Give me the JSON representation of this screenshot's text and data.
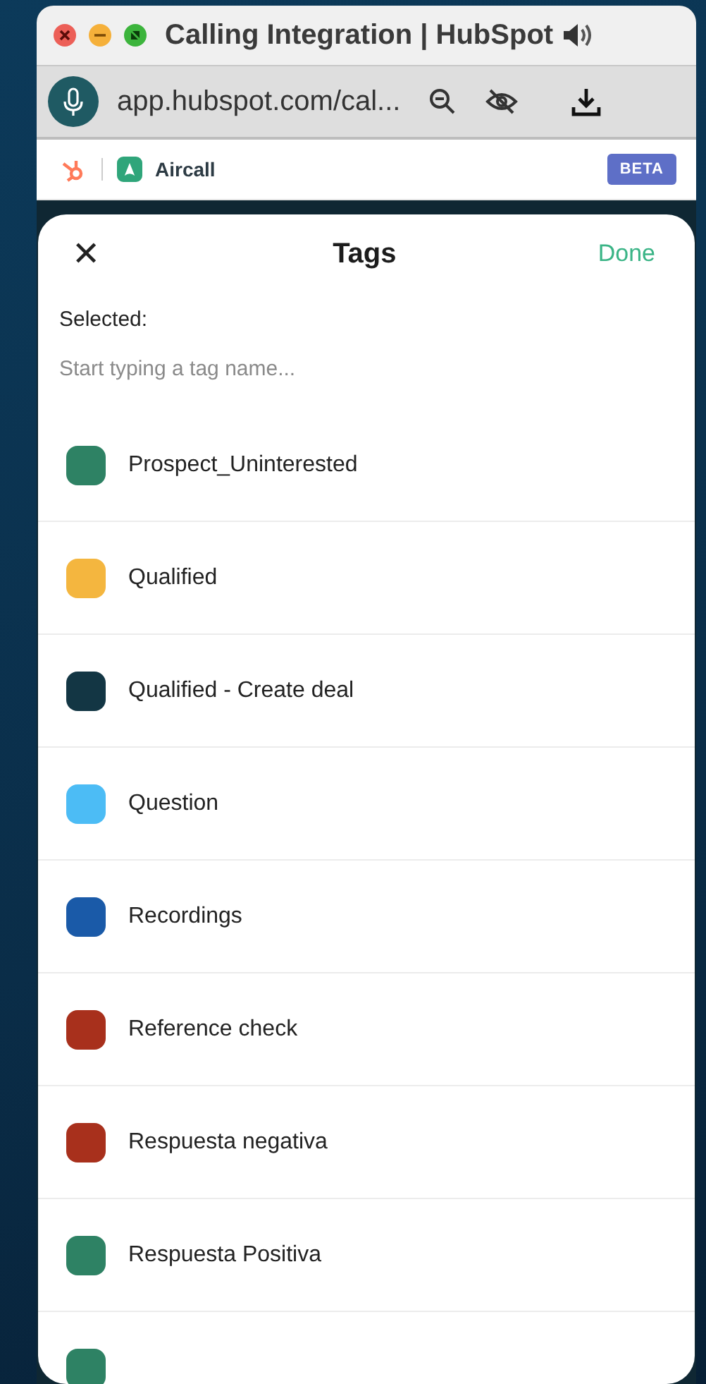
{
  "window": {
    "title": "Calling Integration | HubSpot"
  },
  "address_bar": {
    "url": "app.hubspot.com/cal..."
  },
  "extension_bar": {
    "app_name": "Aircall",
    "badge": "BETA"
  },
  "sheet": {
    "close": "✕",
    "title": "Tags",
    "done": "Done",
    "selected_label": "Selected:",
    "search": {
      "placeholder": "Start typing a tag name..."
    }
  },
  "tags": [
    {
      "label": "Prospect_Uninterested",
      "color": "#2e8264"
    },
    {
      "label": "Qualified",
      "color": "#f4b63f"
    },
    {
      "label": "Qualified - Create deal",
      "color": "#133644"
    },
    {
      "label": "Question",
      "color": "#4cbcf5"
    },
    {
      "label": "Recordings",
      "color": "#1a5aa8"
    },
    {
      "label": "Reference check",
      "color": "#a8301c"
    },
    {
      "label": "Respuesta negativa",
      "color": "#a8301c"
    },
    {
      "label": "Respuesta Positiva",
      "color": "#2e8264"
    },
    {
      "color": "#2e8264"
    }
  ]
}
